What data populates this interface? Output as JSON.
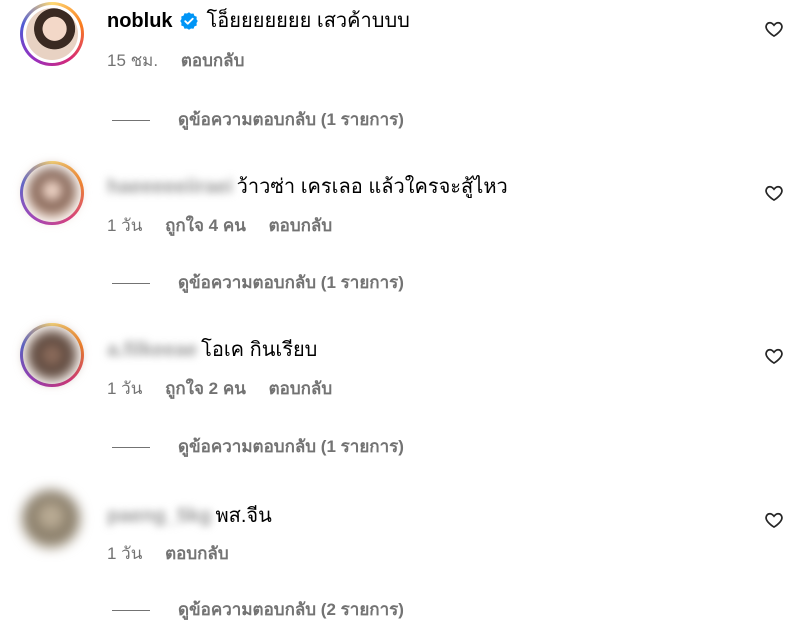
{
  "comments": [
    {
      "username": "nobluk",
      "verified": true,
      "text": "โอ็ยยยยยยย เสวค้าบบบ",
      "time": "15 ชม.",
      "likes": "",
      "reply_label": "ตอบกลับ",
      "view_replies": "ดูข้อความตอบกลับ (1 รายการ)"
    },
    {
      "username": "haeeeeeiiraei",
      "verified": false,
      "text": "ว้าวซ่า เครเลอ แล้วใครจะสู้ไหว",
      "time": "1 วัน",
      "likes": "ถูกใจ 4 คน",
      "reply_label": "ตอบกลับ",
      "view_replies": "ดูข้อความตอบกลับ (1 รายการ)"
    },
    {
      "username": "a.filkeeae",
      "verified": false,
      "text": "โอเค กินเรียบ",
      "time": "1 วัน",
      "likes": "ถูกใจ 2 คน",
      "reply_label": "ตอบกลับ",
      "view_replies": "ดูข้อความตอบกลับ (1 รายการ)"
    },
    {
      "username": "paeng_5kg",
      "verified": false,
      "text": "พส.จีน",
      "time": "1 วัน",
      "likes": "",
      "reply_label": "ตอบกลับ",
      "view_replies": "ดูข้อความตอบกลับ (2 รายการ)"
    }
  ],
  "icons": {
    "verified": "verified-badge-icon",
    "like": "heart-outline-icon"
  },
  "colors": {
    "verified": "#0095f6",
    "secondary_text": "#737373",
    "primary_text": "#000000",
    "story_ring_start": "#feda75",
    "story_ring_end": "#d62976"
  }
}
